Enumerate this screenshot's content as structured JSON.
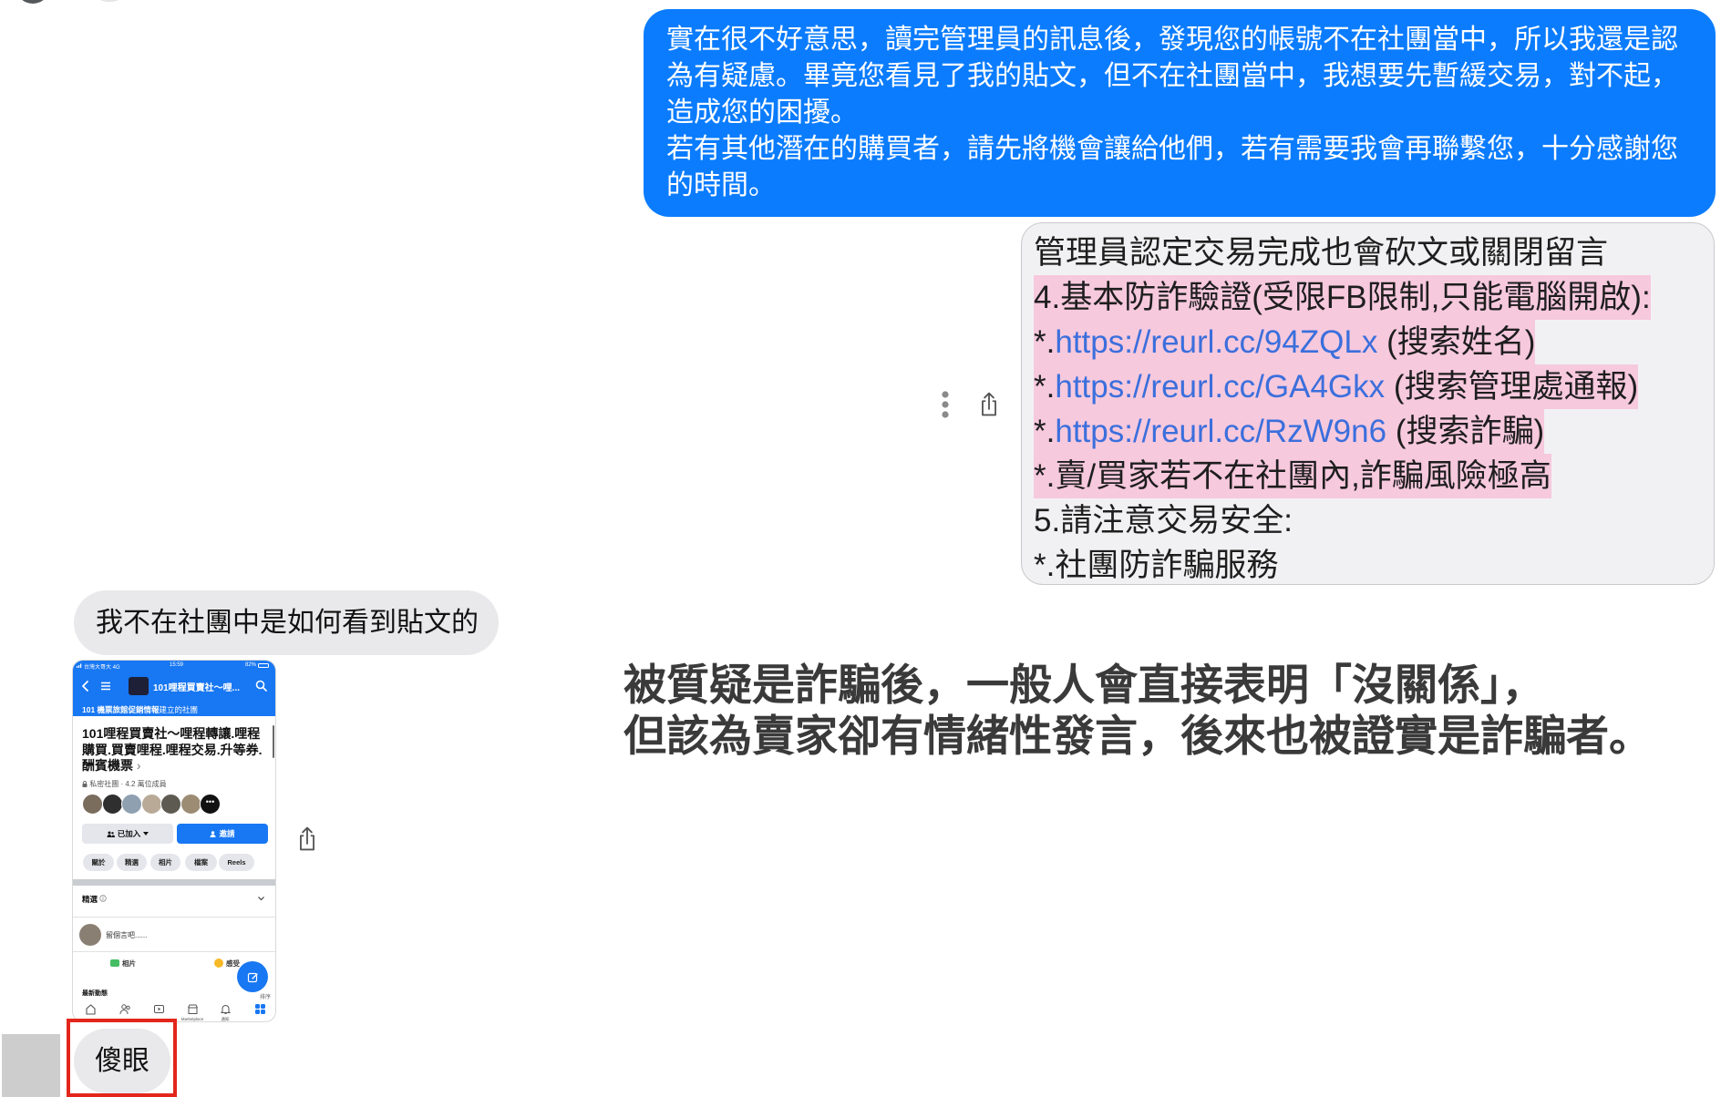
{
  "conversation": {
    "sent_message": {
      "lines": [
        "實在很不好意思，讀完管理員的訊息後，發現您的帳號不在社團當中，所以我還是認",
        "為有疑慮。畢竟您看見了我的貼文，但不在社團當中，我想要先暫緩交易，對不起，",
        "造成您的困擾。",
        "若有其他潛在的購買者，請先將機會讓給他們，若有需要我會再聯繫您，十分感謝您",
        "的時間。"
      ]
    },
    "sent_image": {
      "lines": [
        {
          "text": "管理員認定交易完成也會砍文或關閉留言",
          "highlight": false
        },
        {
          "text": "4.基本防詐驗證(受限FB限制,只能電腦開啟):",
          "highlight": true
        },
        {
          "prefix": "*.",
          "link": "https://reurl.cc/94ZQLx",
          "suffix": " (搜索姓名)",
          "highlight": true
        },
        {
          "prefix": "*.",
          "link": "https://reurl.cc/GA4Gkx",
          "suffix": " (搜索管理處通報)",
          "highlight": true
        },
        {
          "prefix": "*.",
          "link": "https://reurl.cc/RzW9n6",
          "suffix": " (搜索詐騙)",
          "highlight": true
        },
        {
          "text": "*.賣/買家若不在社團內,詐騙風險極高",
          "highlight": true
        },
        {
          "text": "5.請注意交易安全:",
          "highlight": false
        },
        {
          "text": "*.社團防詐騙服務",
          "highlight": false
        }
      ],
      "actions": [
        "more-options-icon",
        "share-icon"
      ]
    },
    "received_message_1": {
      "text": "我不在社團中是如何看到貼文的"
    },
    "received_image": {
      "status_bar": {
        "carrier": "台灣大哥大 4G",
        "time": "15:59",
        "battery": "82%"
      },
      "header": {
        "title": "101哩程買賣社～哩...",
        "creator": "101 機票旅館促銷情報",
        "creator_suffix": "建立的社團"
      },
      "group_name": "101哩程買賣社～哩程轉讓.哩程購買.買賣哩程.哩程交易.升等券.酬賓機票",
      "privacy": "私密社團 · 4.2 萬位成員",
      "joined_button": "已加入",
      "invite_button": "邀請",
      "tabs": [
        "關於",
        "精選",
        "相片",
        "檔案",
        "Reels"
      ],
      "featured_label": "精選",
      "composer_placeholder": "留個言吧......",
      "photo_action": "相片",
      "feeling_action": "感受",
      "latest_label": "最新動態",
      "sort_label": "排序",
      "bottom_nav": [
        {
          "icon": "home-icon"
        },
        {
          "icon": "friends-icon"
        },
        {
          "icon": "video-icon"
        },
        {
          "icon": "marketplace-icon",
          "label": "Marketplace"
        },
        {
          "icon": "bell-icon",
          "label": "通知"
        },
        {
          "icon": "menu-grid-icon"
        }
      ],
      "actions": [
        "share-icon"
      ]
    },
    "received_message_2": {
      "text": "傻眼"
    }
  },
  "annotation": {
    "lines": [
      "被質疑是詐騙後，一般人會直接表明「沒關係」，",
      "但該為賣家卻有情緒性發言，後來也被證實是詐騙者。"
    ]
  },
  "colors": {
    "sent_bubble": "#0b7cfe",
    "received_bubble": "#e9e9eb",
    "highlight": "#f7c9dd",
    "link": "#3b6fdc",
    "annotation_text": "#3a3a3a",
    "callout_border": "#e3261b",
    "fb_blue": "#1877f2"
  }
}
